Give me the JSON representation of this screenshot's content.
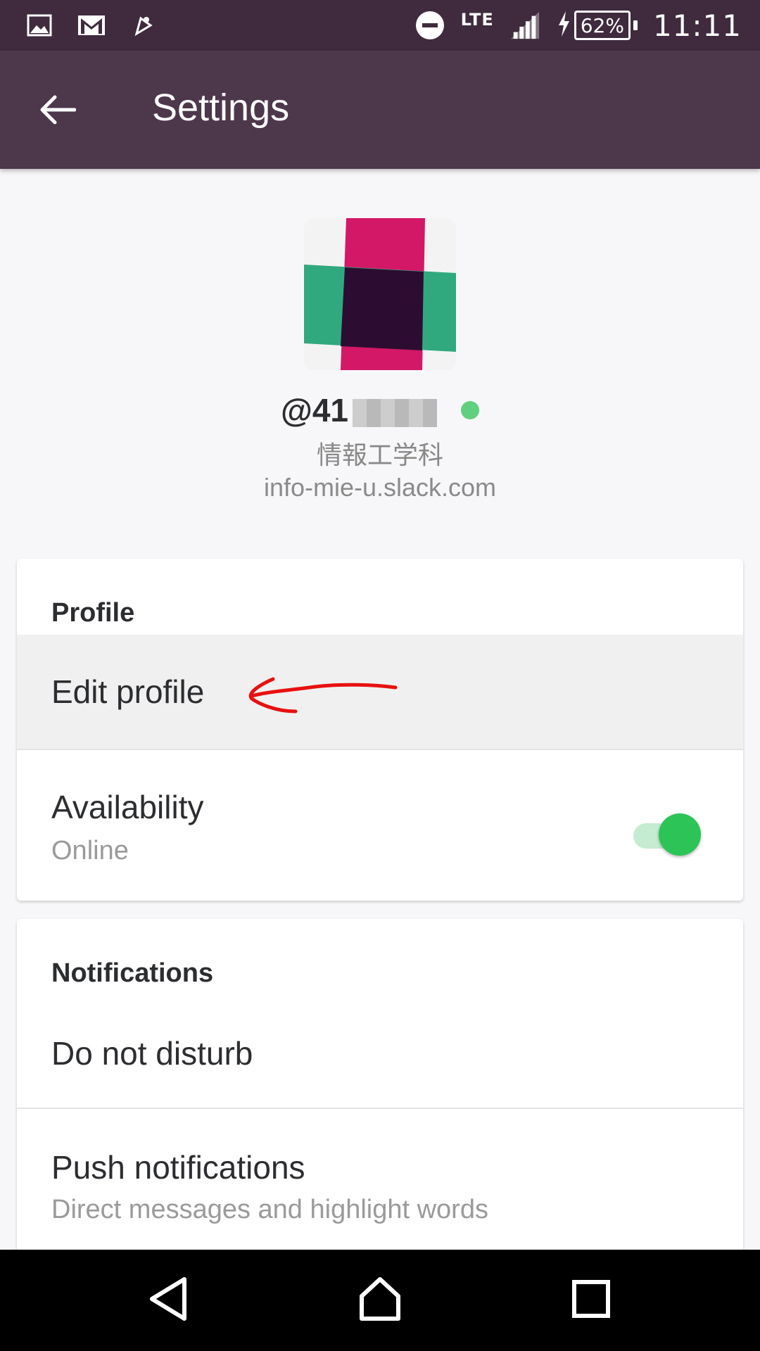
{
  "status_bar": {
    "left_icons": [
      "image-icon",
      "gmail-icon",
      "music-icon"
    ],
    "network": "LTE",
    "battery": "62%",
    "time": "11:11"
  },
  "app_bar": {
    "title": "Settings",
    "back_icon": "arrow-left-icon"
  },
  "profile_header": {
    "username_visible": "@41",
    "presence": "online",
    "team_name": "情報工学科",
    "team_domain": "info-mie-u.slack.com"
  },
  "profile_section": {
    "header": "Profile",
    "edit_label": "Edit profile",
    "availability_label": "Availability",
    "availability_value": "Online",
    "availability_enabled": true
  },
  "notifications_section": {
    "header": "Notifications",
    "dnd_label": "Do not disturb",
    "push_label": "Push notifications",
    "push_value": "Direct messages and highlight words"
  },
  "colors": {
    "status_bar": "#3f2b3d",
    "app_bar": "#4d374b",
    "toggle_on": "#2cc457",
    "presence": "#5fd07e",
    "annotation": "#e81010"
  },
  "nav_bar": [
    "back-triangle-icon",
    "home-icon",
    "recents-icon"
  ]
}
